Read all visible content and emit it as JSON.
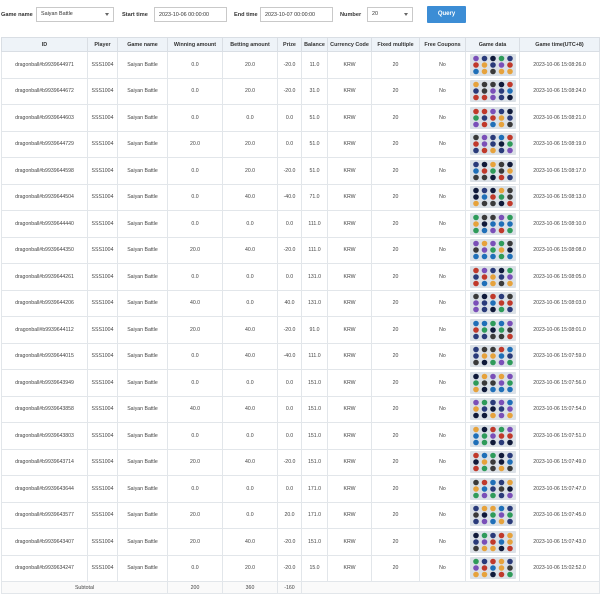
{
  "filters": {
    "game_name_label": "Game name",
    "game_name_value": "Saiyan Battle",
    "start_time_label": "Start time",
    "start_time_value": "2023-10-06 00:00:00",
    "end_time_label": "End time",
    "end_time_value": "2023-10-07 00:00:00",
    "number_label": "Number",
    "number_value": "20",
    "query_label": "Query"
  },
  "table": {
    "headers": [
      "ID",
      "Player",
      "Game name",
      "Winning amount",
      "Betting amount",
      "Prize",
      "Balance",
      "Currency Code",
      "Fixed multiple",
      "Free Coupons",
      "Game data",
      "Game time(UTC+8)"
    ],
    "rows": [
      [
        "dragonball#b9939644971",
        "SSS1004",
        "Saiyan Battle",
        "0.0",
        "20.0",
        "-20.0",
        "11.0",
        "KRW",
        "20",
        "No",
        "",
        "2023-10-06 15:08:26.0"
      ],
      [
        "dragonball#b9939644672",
        "SSS1004",
        "Saiyan Battle",
        "0.0",
        "20.0",
        "-20.0",
        "31.0",
        "KRW",
        "20",
        "No",
        "",
        "2023-10-06 15:08:24.0"
      ],
      [
        "dragonball#b9939644603",
        "SSS1004",
        "Saiyan Battle",
        "0.0",
        "0.0",
        "0.0",
        "51.0",
        "KRW",
        "20",
        "No",
        "",
        "2023-10-06 15:08:21.0"
      ],
      [
        "dragonball#b9939644729",
        "SSS1004",
        "Saiyan Battle",
        "20.0",
        "20.0",
        "0.0",
        "51.0",
        "KRW",
        "20",
        "No",
        "",
        "2023-10-06 15:08:19.0"
      ],
      [
        "dragonball#b9939644598",
        "SSS1004",
        "Saiyan Battle",
        "0.0",
        "20.0",
        "-20.0",
        "51.0",
        "KRW",
        "20",
        "No",
        "",
        "2023-10-06 15:08:17.0"
      ],
      [
        "dragonball#b9939644504",
        "SSS1004",
        "Saiyan Battle",
        "0.0",
        "40.0",
        "-40.0",
        "71.0",
        "KRW",
        "20",
        "No",
        "",
        "2023-10-06 15:08:13.0"
      ],
      [
        "dragonball#b9939644440",
        "SSS1004",
        "Saiyan Battle",
        "0.0",
        "0.0",
        "0.0",
        "111.0",
        "KRW",
        "20",
        "No",
        "",
        "2023-10-06 15:08:10.0"
      ],
      [
        "dragonball#b9939644350",
        "SSS1004",
        "Saiyan Battle",
        "20.0",
        "40.0",
        "-20.0",
        "111.0",
        "KRW",
        "20",
        "No",
        "",
        "2023-10-06 15:08:08.0"
      ],
      [
        "dragonball#b9939644261",
        "SSS1004",
        "Saiyan Battle",
        "0.0",
        "0.0",
        "0.0",
        "131.0",
        "KRW",
        "20",
        "No",
        "",
        "2023-10-06 15:08:05.0"
      ],
      [
        "dragonball#b9939644206",
        "SSS1004",
        "Saiyan Battle",
        "40.0",
        "0.0",
        "40.0",
        "131.0",
        "KRW",
        "20",
        "No",
        "",
        "2023-10-06 15:08:03.0"
      ],
      [
        "dragonball#b9939644112",
        "SSS1004",
        "Saiyan Battle",
        "20.0",
        "40.0",
        "-20.0",
        "91.0",
        "KRW",
        "20",
        "No",
        "",
        "2023-10-06 15:08:01.0"
      ],
      [
        "dragonball#b9939644015",
        "SSS1004",
        "Saiyan Battle",
        "0.0",
        "40.0",
        "-40.0",
        "111.0",
        "KRW",
        "20",
        "No",
        "",
        "2023-10-06 15:07:59.0"
      ],
      [
        "dragonball#b9939643949",
        "SSS1004",
        "Saiyan Battle",
        "0.0",
        "0.0",
        "0.0",
        "151.0",
        "KRW",
        "20",
        "No",
        "",
        "2023-10-06 15:07:56.0"
      ],
      [
        "dragonball#b9939643858",
        "SSS1004",
        "Saiyan Battle",
        "40.0",
        "40.0",
        "0.0",
        "151.0",
        "KRW",
        "20",
        "No",
        "",
        "2023-10-06 15:07:54.0"
      ],
      [
        "dragonball#b9939643803",
        "SSS1004",
        "Saiyan Battle",
        "0.0",
        "0.0",
        "0.0",
        "151.0",
        "KRW",
        "20",
        "No",
        "",
        "2023-10-06 15:07:51.0"
      ],
      [
        "dragonball#b9939643714",
        "SSS1004",
        "Saiyan Battle",
        "20.0",
        "40.0",
        "-20.0",
        "151.0",
        "KRW",
        "20",
        "No",
        "",
        "2023-10-06 15:07:49.0"
      ],
      [
        "dragonball#b9939643644",
        "SSS1004",
        "Saiyan Battle",
        "0.0",
        "0.0",
        "0.0",
        "171.0",
        "KRW",
        "20",
        "No",
        "",
        "2023-10-06 15:07:47.0"
      ],
      [
        "dragonball#b9939643577",
        "SSS1004",
        "Saiyan Battle",
        "20.0",
        "0.0",
        "20.0",
        "171.0",
        "KRW",
        "20",
        "No",
        "",
        "2023-10-06 15:07:45.0"
      ],
      [
        "dragonball#b9939643407",
        "SSS1004",
        "Saiyan Battle",
        "20.0",
        "40.0",
        "-20.0",
        "151.0",
        "KRW",
        "20",
        "No",
        "",
        "2023-10-06 15:07:43.0"
      ],
      [
        "dragonball#b9939634247",
        "SSS1004",
        "Saiyan Battle",
        "0.0",
        "20.0",
        "-20.0",
        "15.0",
        "KRW",
        "20",
        "No",
        "",
        "2023-10-06 15:02:52.0"
      ]
    ],
    "subtotal": {
      "label": "Subtotal",
      "winning": "200",
      "betting": "360",
      "prize": "-160"
    }
  },
  "colors": {
    "query_button": "#3c8dd5",
    "header_bg": "#eef3f8",
    "game_data_bg": "#dbe1e7"
  }
}
